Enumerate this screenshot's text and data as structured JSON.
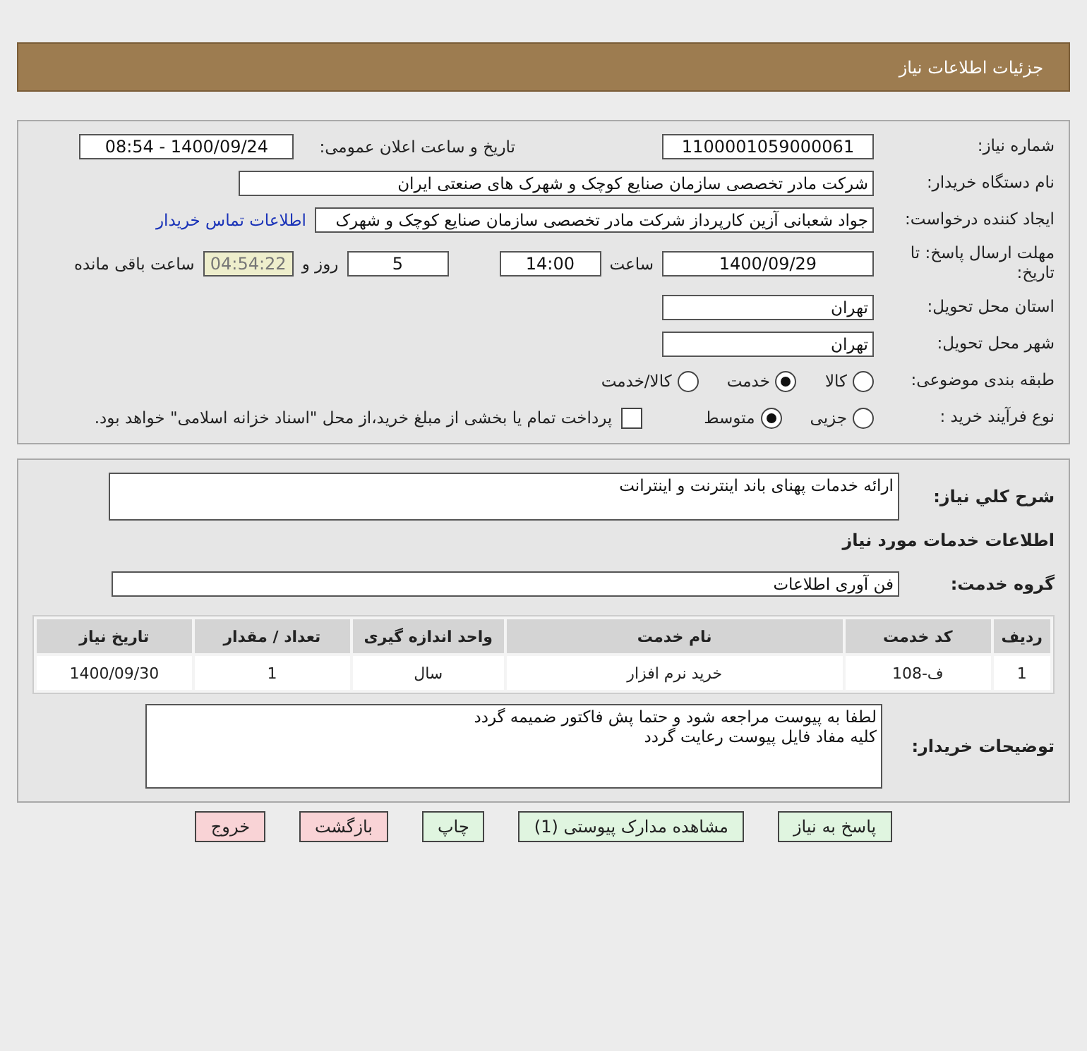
{
  "header": {
    "title": "جزئیات اطلاعات نیاز"
  },
  "need_number": {
    "label": "شماره نیاز:",
    "value": "1100001059000061"
  },
  "announce": {
    "label": "تاریخ و ساعت اعلان عمومی:",
    "value": "1400/09/24 - 08:54"
  },
  "buyer": {
    "label": "نام دستگاه خریدار:",
    "value": "شرکت مادر تخصصی سازمان صنایع کوچک و شهرک های صنعتی ایران"
  },
  "creator": {
    "label": "ایجاد کننده درخواست:",
    "value": "جواد  شعبانی آزین کارپرداز  شرکت مادر تخصصی سازمان صنایع کوچک و شهرک",
    "link": "اطلاعات تماس خریدار"
  },
  "deadline": {
    "label": "مهلت ارسال پاسخ: تا تاریخ:",
    "date": "1400/09/29",
    "time_label": "ساعت",
    "time": "14:00",
    "days": "5",
    "days_label": "روز و",
    "remaining": "04:54:22",
    "remaining_label": "ساعت باقی مانده"
  },
  "province": {
    "label": "استان محل تحویل:",
    "value": "تهران"
  },
  "city": {
    "label": "شهر محل تحویل:",
    "value": "تهران"
  },
  "category": {
    "label": "طبقه بندی موضوعی:",
    "options": [
      {
        "label": "کالا",
        "selected": false
      },
      {
        "label": "خدمت",
        "selected": true
      },
      {
        "label": "کالا/خدمت",
        "selected": false
      }
    ]
  },
  "process": {
    "label": "نوع فرآیند خرید :",
    "options": [
      {
        "label": "جزیی",
        "selected": false
      },
      {
        "label": "متوسط",
        "selected": true
      }
    ],
    "payment": {
      "label": "پرداخت تمام یا بخشی از مبلغ خرید،از محل \"اسناد خزانه اسلامی\" خواهد بود.",
      "checked": false
    }
  },
  "description": {
    "label": "شرح کلي نياز:",
    "value": "ارائه خدمات پهنای باند اینترنت و اینترانت"
  },
  "services_heading": "اطلاعات خدمات مورد نیاز",
  "service_group": {
    "label": "گروه خدمت:",
    "value": "فن آوری اطلاعات"
  },
  "table": {
    "columns": [
      "ردیف",
      "کد خدمت",
      "نام خدمت",
      "واحد اندازه گیری",
      "تعداد / مقدار",
      "تاریخ نیاز"
    ],
    "rows": [
      [
        "1",
        "ف-108",
        "خرید نرم افزار",
        "سال",
        "1",
        "1400/09/30"
      ]
    ]
  },
  "notes": {
    "label": "توضیحات خریدار:",
    "lines": [
      "لطفا به پیوست مراجعه شود و حتما پش فاکتور ضمیمه گردد",
      "کلیه مفاد فایل پیوست رعایت گردد"
    ]
  },
  "buttons": [
    {
      "label": "پاسخ به نیاز",
      "kind": "action"
    },
    {
      "label": "مشاهده مدارک پیوستی (1)",
      "kind": "action"
    },
    {
      "label": "چاپ",
      "kind": "action"
    },
    {
      "label": "بازگشت",
      "kind": "exit"
    },
    {
      "label": "خروج",
      "kind": "exit"
    }
  ]
}
